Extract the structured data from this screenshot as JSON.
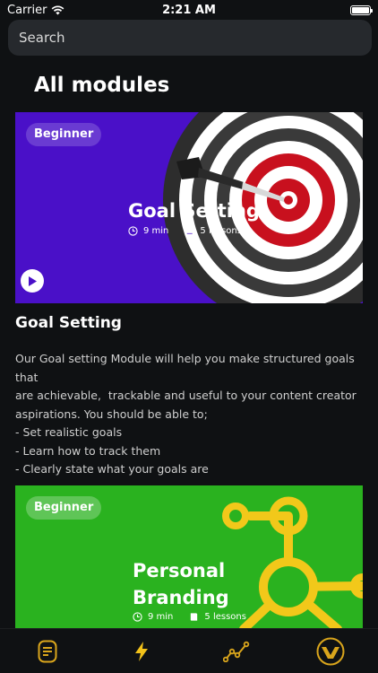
{
  "status_bar": {
    "carrier": "Carrier",
    "time": "2:21 AM"
  },
  "search": {
    "placeholder": "Search"
  },
  "page_title": "All modules",
  "modules": [
    {
      "badge": "Beginner",
      "title": "Goal Setting",
      "duration": "9 min",
      "lessons": "5 lessons",
      "heading": "Goal Setting",
      "description": [
        "Our Goal setting Module will help you make structured goals that",
        "are achievable,  trackable and useful to your content creator",
        "aspirations. You should be able to;",
        "- Set realistic goals",
        "- Learn how to track them",
        "- Clearly state what your goals are"
      ],
      "color": "#4a10c8"
    },
    {
      "badge": "Beginner",
      "title_line1": "Personal",
      "title_line2": "Branding",
      "duration": "9 min",
      "lessons": "5 lessons",
      "color": "#2ab21f"
    }
  ],
  "tabbar": {
    "items": [
      "notes-icon",
      "lightning-icon",
      "chart-line-icon",
      "logo-icon"
    ],
    "accent": "#d9a51c",
    "active": "#f2c21a"
  }
}
